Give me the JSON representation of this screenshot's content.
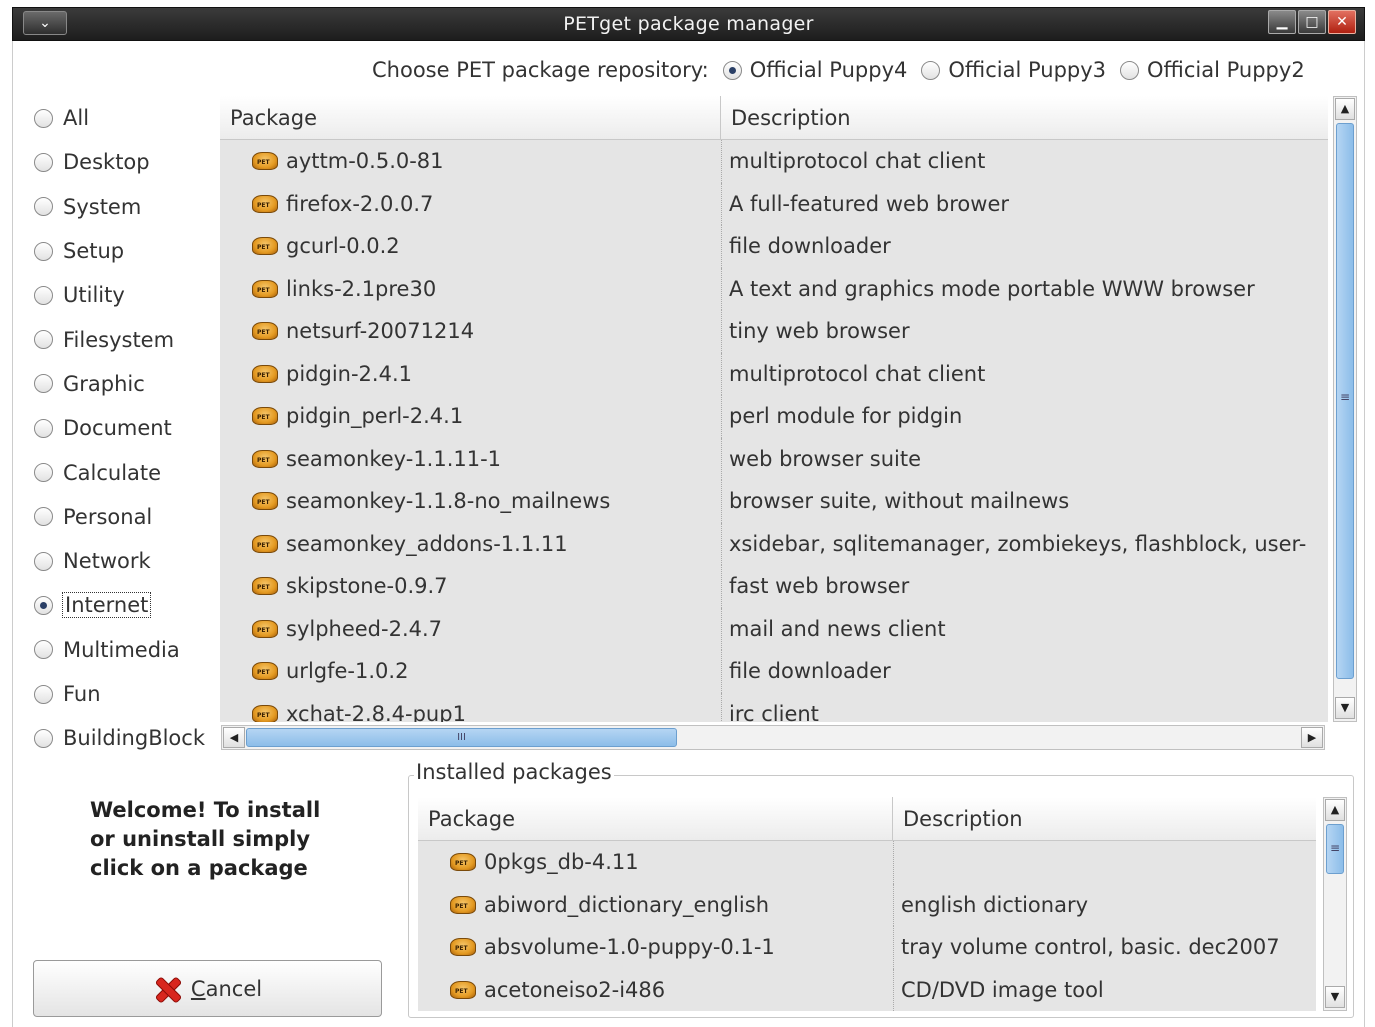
{
  "window": {
    "title": "PETget package manager",
    "menu_glyph": "⌄",
    "controls": {
      "minimize": "▁",
      "maximize": "□",
      "close": "✕"
    }
  },
  "repository": {
    "label": "Choose PET package repository:",
    "options": [
      {
        "label": "Official Puppy4",
        "selected": true
      },
      {
        "label": "Official Puppy3",
        "selected": false
      },
      {
        "label": "Official Puppy2",
        "selected": false
      }
    ]
  },
  "categories": [
    {
      "label": "All",
      "selected": false
    },
    {
      "label": "Desktop",
      "selected": false
    },
    {
      "label": "System",
      "selected": false
    },
    {
      "label": "Setup",
      "selected": false
    },
    {
      "label": "Utility",
      "selected": false
    },
    {
      "label": "Filesystem",
      "selected": false
    },
    {
      "label": "Graphic",
      "selected": false
    },
    {
      "label": "Document",
      "selected": false
    },
    {
      "label": "Calculate",
      "selected": false
    },
    {
      "label": "Personal",
      "selected": false
    },
    {
      "label": "Network",
      "selected": false
    },
    {
      "label": "Internet",
      "selected": true
    },
    {
      "label": "Multimedia",
      "selected": false
    },
    {
      "label": "Fun",
      "selected": false
    },
    {
      "label": "BuildingBlock",
      "selected": false
    }
  ],
  "packages": {
    "columns": [
      "Package",
      "Description"
    ],
    "rows": [
      {
        "name": "ayttm-0.5.0-81",
        "desc": "multiprotocol chat client"
      },
      {
        "name": "firefox-2.0.0.7",
        "desc": "A full-featured web brower"
      },
      {
        "name": "gcurl-0.0.2",
        "desc": "file downloader"
      },
      {
        "name": "links-2.1pre30",
        "desc": "A text and graphics mode portable WWW browser"
      },
      {
        "name": "netsurf-20071214",
        "desc": "tiny web browser"
      },
      {
        "name": "pidgin-2.4.1",
        "desc": "multiprotocol chat client"
      },
      {
        "name": "pidgin_perl-2.4.1",
        "desc": "perl module for pidgin"
      },
      {
        "name": "seamonkey-1.1.11-1",
        "desc": "web browser suite"
      },
      {
        "name": "seamonkey-1.1.8-no_mailnews",
        "desc": "browser suite, without mailnews"
      },
      {
        "name": "seamonkey_addons-1.1.11",
        "desc": "xsidebar, sqlitemanager, zombiekeys, flashblock, user-"
      },
      {
        "name": "skipstone-0.9.7",
        "desc": "fast web browser"
      },
      {
        "name": "sylpheed-2.4.7",
        "desc": "mail and news client"
      },
      {
        "name": "urlgfe-1.0.2",
        "desc": "file downloader"
      },
      {
        "name": "xchat-2.8.4-pup1",
        "desc": "irc client"
      }
    ]
  },
  "installed": {
    "label": "Installed packages",
    "columns": [
      "Package",
      "Description"
    ],
    "rows": [
      {
        "name": "0pkgs_db-4.11",
        "desc": ""
      },
      {
        "name": "abiword_dictionary_english",
        "desc": "english dictionary"
      },
      {
        "name": "absvolume-1.0-puppy-0.1-1",
        "desc": "tray volume control, basic. dec2007"
      },
      {
        "name": "acetoneiso2-i486",
        "desc": "CD/DVD image tool"
      }
    ]
  },
  "welcome_text": "Welcome! To install or uninstall simply click on a package",
  "cancel": {
    "mnemonic": "C",
    "rest": "ancel"
  },
  "scroll_glyphs": {
    "up": "▲",
    "down": "▼",
    "left": "◀",
    "right": "▶",
    "grip_v": "≡",
    "grip_h": "III"
  }
}
